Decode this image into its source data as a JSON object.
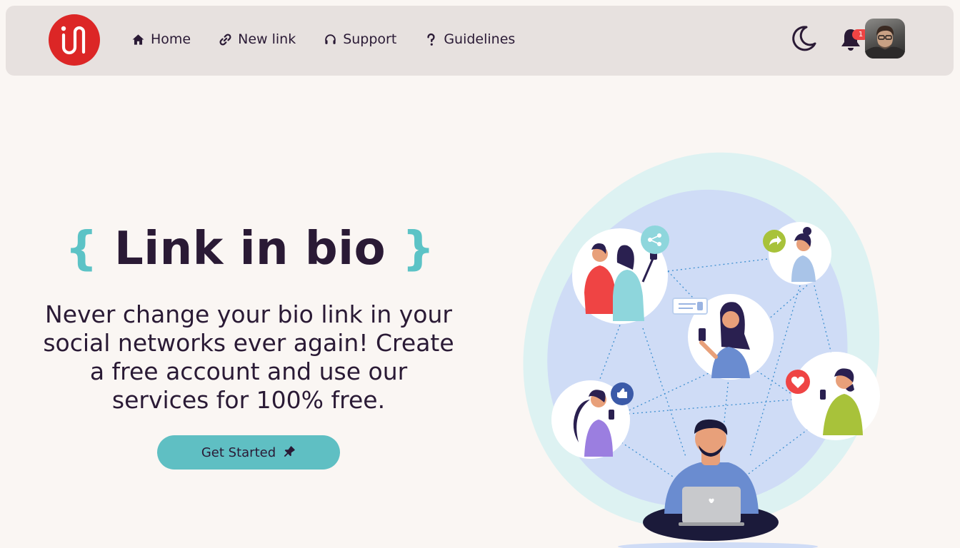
{
  "nav": {
    "items": [
      {
        "label": "Home",
        "icon": "home-icon"
      },
      {
        "label": "New link",
        "icon": "link-icon"
      },
      {
        "label": "Support",
        "icon": "headset-icon"
      },
      {
        "label": "Guidelines",
        "icon": "question-icon"
      }
    ],
    "notification_count": "1"
  },
  "hero": {
    "brace_open": "{",
    "title": "Link in bio",
    "brace_close": "}",
    "subtitle": "Never change your bio link in your social networks ever again! Create a free account and use our services for 100% free.",
    "cta_label": "Get Started"
  },
  "colors": {
    "background": "#faf6f3",
    "navbar": "#e7e1df",
    "logo": "#dc2626",
    "accent": "#5fbfc3",
    "text": "#2a1a35",
    "badge": "#ef4444"
  }
}
